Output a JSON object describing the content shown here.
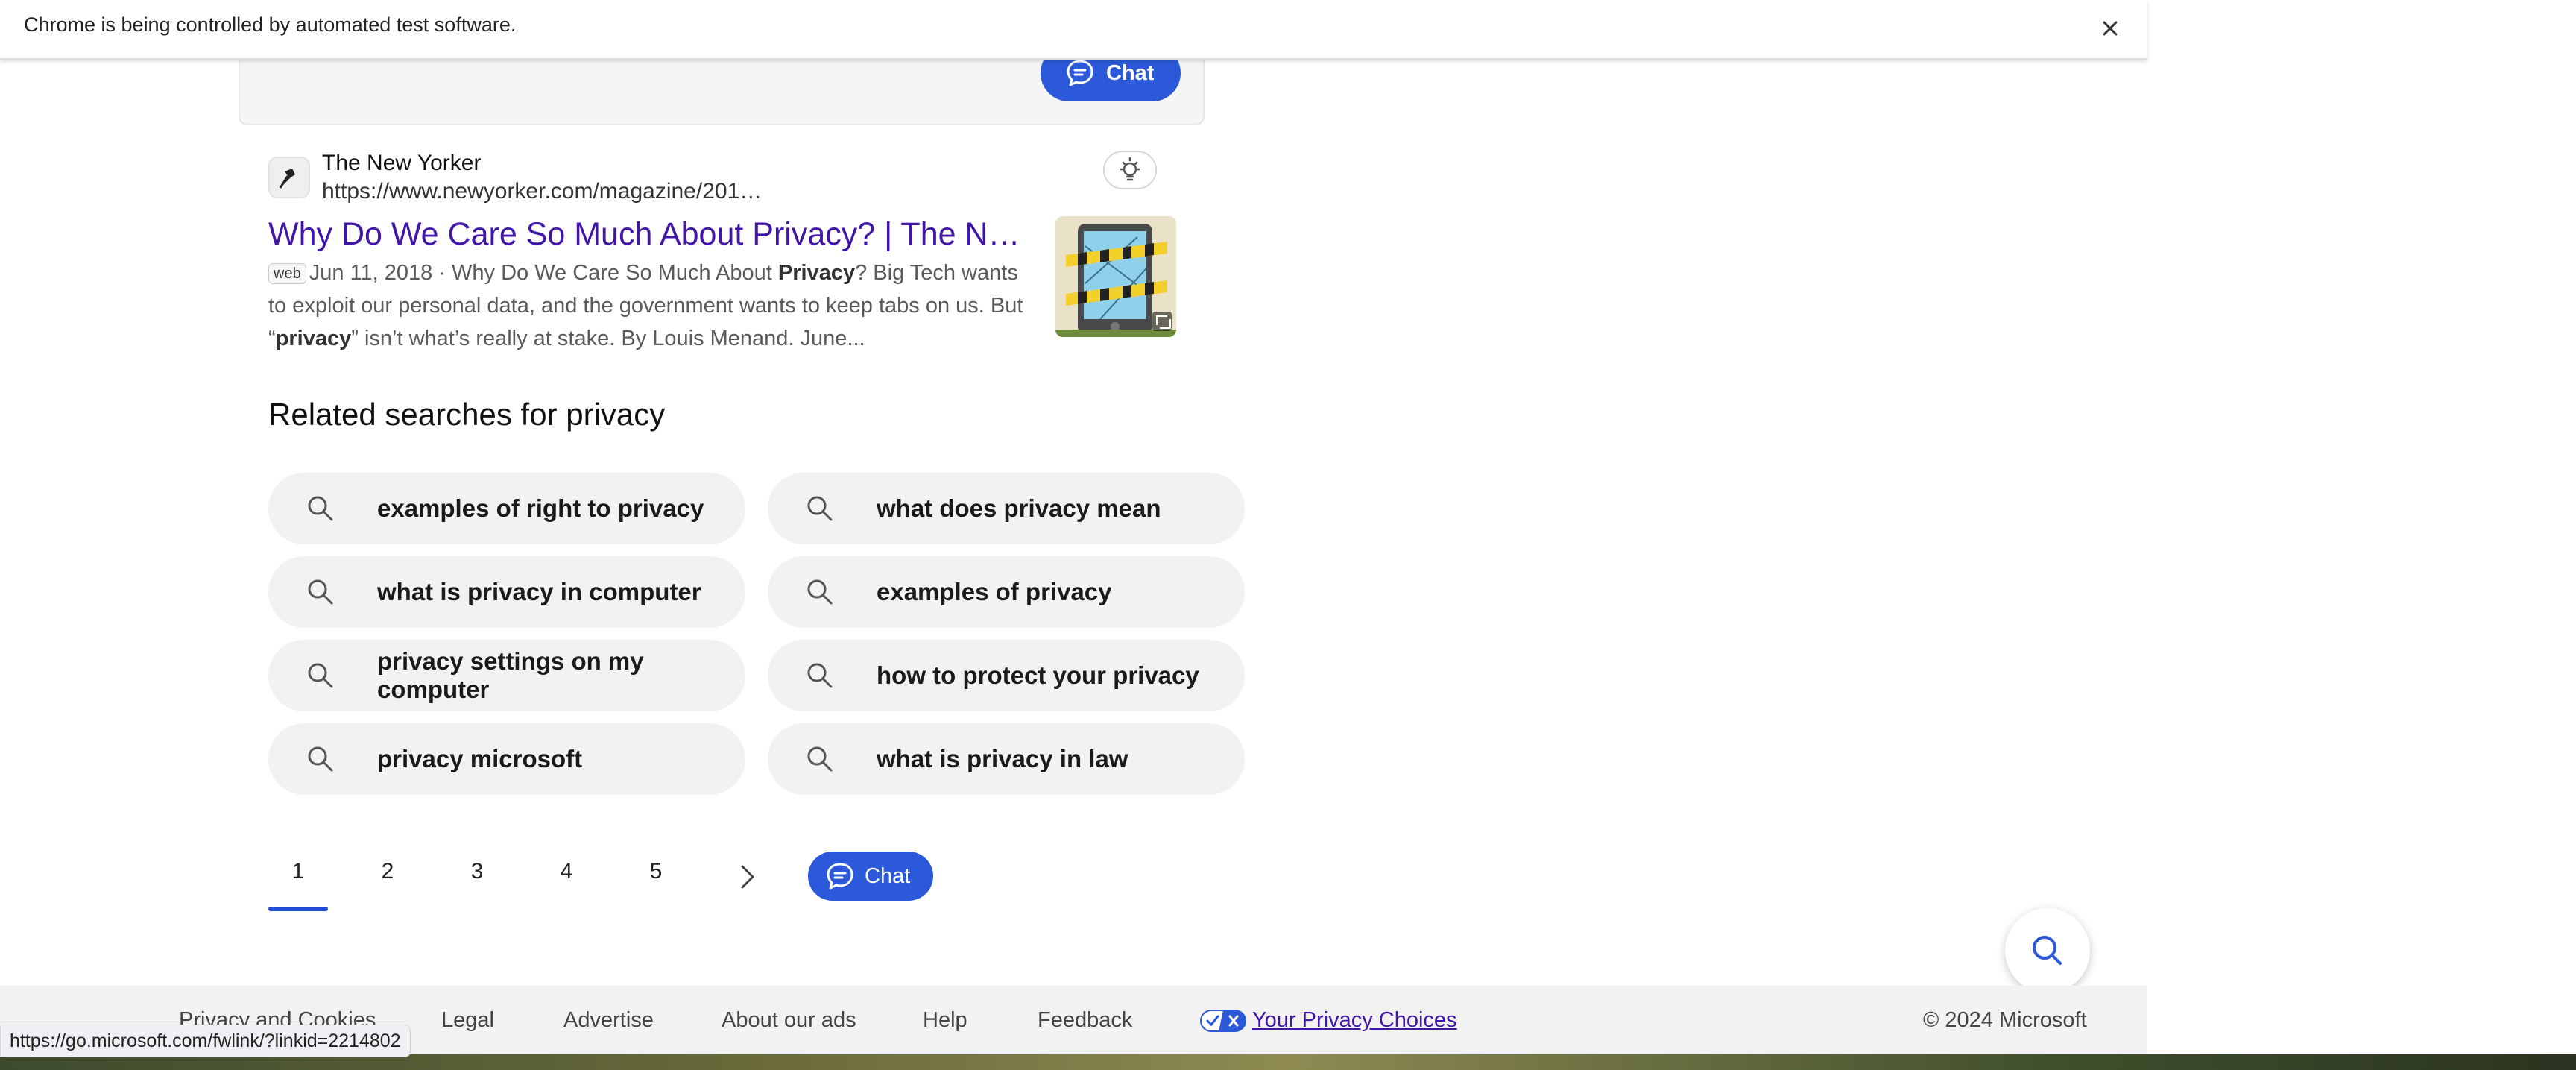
{
  "infobar": {
    "message": "Chrome is being controlled by automated test software."
  },
  "chat_label": "Chat",
  "result": {
    "site_name": "The New Yorker",
    "url": "https://www.newyorker.com/magazine/201…",
    "title": "Why Do We Care So Much About Privacy? | The New …",
    "badge": "web",
    "snippet": {
      "s1": "Jun 11, 2018 · Why Do We Care So Much About ",
      "b1": "Privacy",
      "s2": "? Big Tech wants to exploit our personal data, and the government wants to keep tabs on us. But “",
      "b2": "privacy",
      "s3": "” isn’t what’s really at stake. By Louis Menand. June..."
    }
  },
  "related": {
    "heading": "Related searches for privacy",
    "items": [
      "examples of right to privacy",
      "what does privacy mean",
      "what is privacy in computer",
      "examples of privacy",
      "privacy settings on my computer",
      "how to protect your privacy",
      "privacy microsoft",
      "what is privacy in law"
    ]
  },
  "pagination": {
    "pages": [
      "1",
      "2",
      "3",
      "4",
      "5"
    ],
    "current": "1"
  },
  "footer": {
    "links": [
      "Privacy and Cookies",
      "Legal",
      "Advertise",
      "About our ads",
      "Help",
      "Feedback"
    ],
    "privacy_choices": "Your Privacy Choices",
    "copyright": "© 2024 Microsoft"
  },
  "status_bar": {
    "url": "https://go.microsoft.com/fwlink/?linkid=2214802"
  },
  "colors": {
    "accent": "#2b59d9",
    "link_visited": "#4015a8",
    "pill_bg": "#f1f2f4"
  }
}
